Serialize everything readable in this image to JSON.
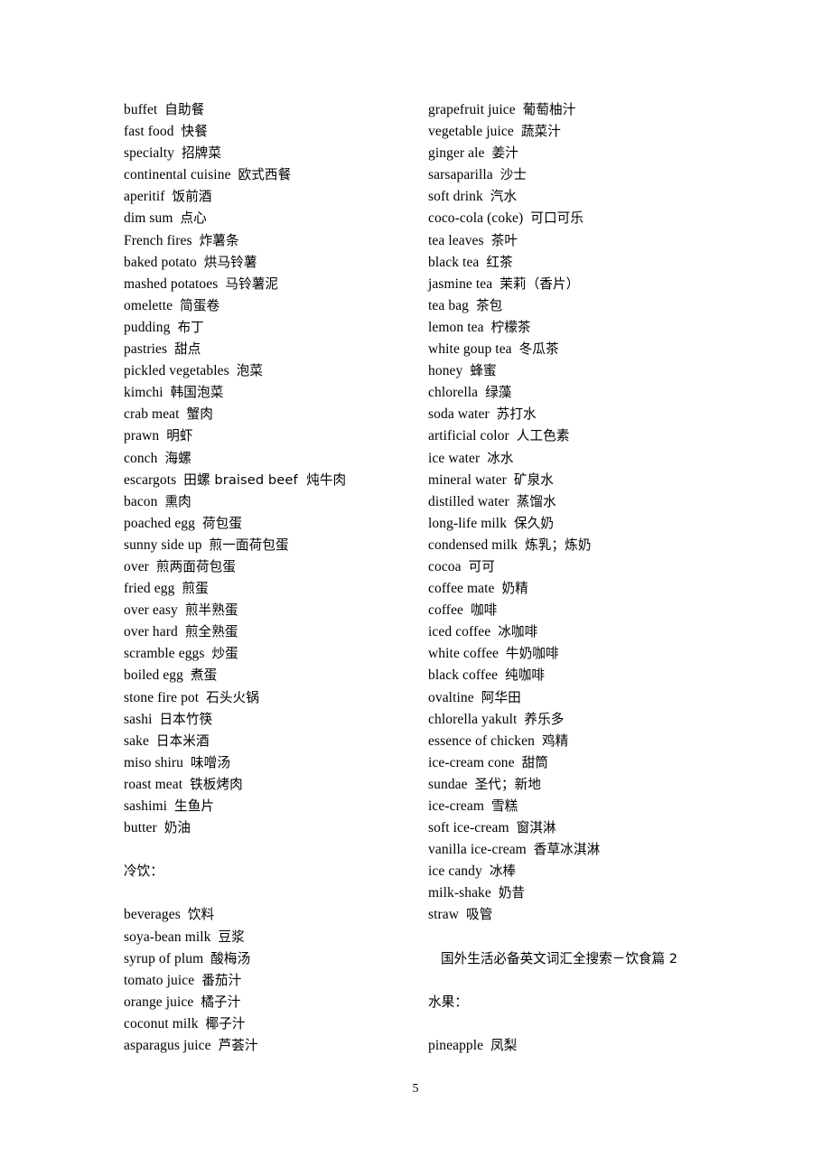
{
  "document": {
    "page_number": "5",
    "heading": "国外生活必备英文词汇全搜索－饮食篇 2"
  },
  "left_column": {
    "entries": [
      "buffet  自助餐",
      "fast food  快餐",
      "specialty  招牌菜",
      "continental cuisine  欧式西餐",
      "aperitif  饭前酒",
      "dim sum  点心",
      "French fires  炸薯条",
      "baked potato  烘马铃薯",
      "mashed potatoes  马铃薯泥",
      "omelette  简蛋卷",
      "pudding  布丁",
      "pastries  甜点",
      "pickled vegetables  泡菜",
      "kimchi  韩国泡菜",
      "crab meat  蟹肉",
      "prawn  明虾",
      "conch  海螺",
      "escargots  田螺 braised beef  炖牛肉",
      "bacon  熏肉",
      "poached egg  荷包蛋",
      "sunny side up  煎一面荷包蛋",
      "over  煎两面荷包蛋",
      "fried egg  煎蛋",
      "over easy  煎半熟蛋",
      "over hard  煎全熟蛋",
      "scramble eggs  炒蛋",
      "boiled egg  煮蛋",
      "stone fire pot  石头火锅",
      "sashi  日本竹筷",
      "sake  日本米酒",
      "miso shiru  味噌汤",
      "roast meat  铁板烤肉",
      "sashimi  生鱼片",
      "butter  奶油"
    ],
    "section_title": "冷饮：",
    "beverage_entries": [
      "beverages  饮料",
      "soya-bean milk  豆浆",
      "syrup of plum  酸梅汤",
      "tomato juice  番茄汁",
      "orange juice  橘子汁",
      "coconut milk  椰子汁",
      "asparagus juice  芦荟汁"
    ]
  },
  "right_column": {
    "entries": [
      "grapefruit juice  葡萄柚汁",
      "vegetable juice  蔬菜汁",
      "ginger ale  姜汁",
      "sarsaparilla  沙士",
      "soft drink  汽水",
      "coco-cola (coke)  可口可乐",
      "tea leaves  茶叶",
      "black tea  红茶",
      "jasmine tea  茉莉（香片）",
      "tea bag  茶包",
      "lemon tea  柠檬茶",
      "white goup tea  冬瓜茶",
      "honey  蜂蜜",
      "chlorella  绿藻",
      "soda water  苏打水",
      "artificial color  人工色素",
      "ice water  冰水",
      "mineral water  矿泉水",
      "distilled water  蒸馏水",
      "long-life milk  保久奶",
      "condensed milk  炼乳；炼奶",
      "cocoa  可可",
      "coffee mate  奶精",
      "coffee  咖啡",
      "iced coffee  冰咖啡",
      "white coffee  牛奶咖啡",
      "black coffee  纯咖啡",
      "ovaltine  阿华田",
      "chlorella yakult  养乐多",
      "essence of chicken  鸡精",
      "ice-cream cone  甜筒",
      "sundae  圣代；新地",
      "ice-cream  雪糕",
      "soft ice-cream  窗淇淋",
      "vanilla ice-cream  香草冰淇淋",
      "ice candy  冰棒",
      "milk-shake  奶昔",
      "straw  吸管"
    ],
    "fruit_section_title": "水果：",
    "fruit_entries": [
      "pineapple  凤梨"
    ]
  }
}
